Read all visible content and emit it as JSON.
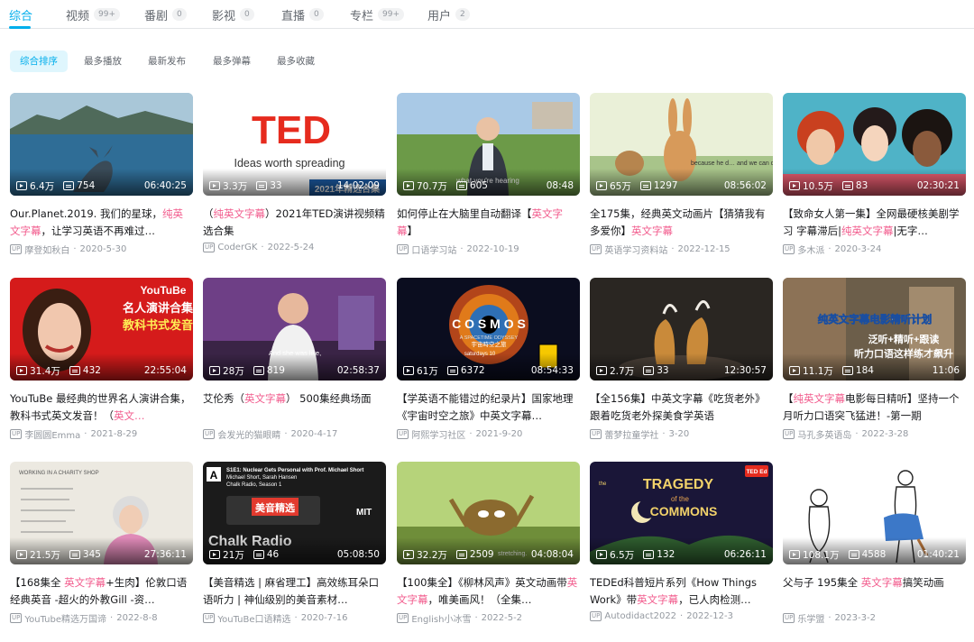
{
  "tabs": [
    {
      "label": "综合",
      "count": ""
    },
    {
      "label": "视频",
      "count": "99+"
    },
    {
      "label": "番剧",
      "count": "0"
    },
    {
      "label": "影视",
      "count": "0"
    },
    {
      "label": "直播",
      "count": "0"
    },
    {
      "label": "专栏",
      "count": "99+"
    },
    {
      "label": "用户",
      "count": "2"
    }
  ],
  "sort": [
    "综合排序",
    "最多播放",
    "最新发布",
    "最多弹幕",
    "最多收藏"
  ],
  "up_badge": "UP",
  "videos": [
    {
      "views": "6.4万",
      "danmaku": "754",
      "duration": "06:40:25",
      "t1": "Our.Planet.2019. 我们的星球，",
      "hl": "纯英文字幕",
      "t2": "，让学习英语不再难过…",
      "author": "摩登如秋白",
      "date": "2020-5-30",
      "overlay": ""
    },
    {
      "views": "3.3万",
      "danmaku": "33",
      "duration": "14:02:09",
      "t1": "（",
      "hl": "纯英文字幕",
      "t2": "）2021年TED演讲视频精选合集",
      "author": "CoderGK",
      "date": "2022-5-24",
      "overlay": "TED|Ideas worth spreading|2021年精选合集"
    },
    {
      "views": "70.7万",
      "danmaku": "605",
      "duration": "08:48",
      "t1": "如何停止在大脑里自动翻译【",
      "hl": "英文字幕",
      "t2": "】",
      "author": "口语学习站",
      "date": "2022-10-19",
      "overlay": "what you're hearing"
    },
    {
      "views": "65万",
      "danmaku": "1297",
      "duration": "08:56:02",
      "t1": "全175集，经典英文动画片【猜猜我有多爱你】",
      "hl": "英文字幕",
      "t2": "",
      "author": "英语学习资料站",
      "date": "2022-12-15",
      "overlay": "because he d… and we can d…"
    },
    {
      "views": "10.5万",
      "danmaku": "83",
      "duration": "02:30:21",
      "t1": "【致命女人第一集】全网最硬核美剧学习 字幕滞后|",
      "hl": "纯英文字幕",
      "t2": "|无字…",
      "author": "多木派",
      "date": "2020-3-24",
      "overlay": ""
    },
    {
      "views": "31.4万",
      "danmaku": "432",
      "duration": "22:55:04",
      "t1": "YouTuBe 最经典的世界名人演讲合集，教科书式英文发音！（",
      "hl": "英文…",
      "t2": "",
      "author": "李圆圆Emma",
      "date": "2021-8-29",
      "overlay": "YouTuBe|名人演讲合集|教科书式发音"
    },
    {
      "views": "28万",
      "danmaku": "819",
      "duration": "02:58:37",
      "t1": "艾伦秀（",
      "hl": "英文字幕",
      "t2": "） 500集经典场面",
      "author": "会发光的猫眼睛",
      "date": "2020-4-17",
      "overlay": "And she was like,"
    },
    {
      "views": "61万",
      "danmaku": "6372",
      "duration": "08:54:33",
      "t1": "【学英语不能错过的纪录片】国家地理《宇宙时空之旅》中英文字幕…",
      "hl": "",
      "t2": "",
      "author": "阿熙学习社区",
      "date": "2021-9-20",
      "overlay": "C O S M O S|A SPACETIME ODYSSEY|宇宙時空之旅|saturdays 10"
    },
    {
      "views": "2.7万",
      "danmaku": "33",
      "duration": "12:30:57",
      "t1": "【全156集】中英文字幕《吃货老外》跟着吃货老外探美食学英语",
      "hl": "",
      "t2": "",
      "author": "蕾梦拉童学社",
      "date": "3-20",
      "overlay": ""
    },
    {
      "views": "11.1万",
      "danmaku": "184",
      "duration": "11:06",
      "t1": "【",
      "hl": "纯英文字幕",
      "t2": "电影每日精听】坚持一个月听力口语突飞猛进！-第一期",
      "author": "马孔多英语岛",
      "date": "2022-3-28",
      "overlay": "纯英文字幕电影精听计划|泛听+精听+跟读|听力口语这样练才飙升"
    },
    {
      "views": "21.5万",
      "danmaku": "345",
      "duration": "27:36:11",
      "t1": "【168集全 ",
      "hl": "英文字幕",
      "t2": "+生肉】伦敦口语 经典英音 -超火的外教Gill -资…",
      "author": "YouTube精选万国谛",
      "date": "2022-8-8",
      "overlay": "WORKING IN A CHARITY SHOP"
    },
    {
      "views": "21万",
      "danmaku": "46",
      "duration": "05:08:50",
      "t1": "【美音精选 | 麻省理工】高效练耳朵口语听力 | 神仙级别的美音素材…",
      "hl": "",
      "t2": "",
      "author": "YouTuBe口语精选",
      "date": "2020-7-16",
      "overlay": "S1E1: Nuclear Gets Personal with Prof. Michael Short|Michael Short, Sarah Hansen|Chalk Radio, Season 1|美音精选|Chalk Radio|MIT"
    },
    {
      "views": "32.2万",
      "danmaku": "2509",
      "duration": "04:08:04",
      "t1": "【100集全】《柳林风声》英文动画带",
      "hl": "英文字幕",
      "t2": "，唯美画风！（全集…",
      "author": "English小冰雪",
      "date": "2022-5-2",
      "overlay": "stretching."
    },
    {
      "views": "6.5万",
      "danmaku": "132",
      "duration": "06:26:11",
      "t1": "TEDEd科普短片系列《How Things Work》带",
      "hl": "英文字幕",
      "t2": "，已人肉检测…",
      "author": "Autodidact2022",
      "date": "2022-12-3",
      "overlay": "the TRAGEDY|of the|COMMONS|TED Ed"
    },
    {
      "views": "108.1万",
      "danmaku": "4588",
      "duration": "01:40:21",
      "t1": "父与子 195集全 ",
      "hl": "英文字幕",
      "t2": "搞笑动画",
      "author": "乐学盟",
      "date": "2023-3-2",
      "overlay": ""
    }
  ],
  "colors": {
    "accent": "#00aeec",
    "highlight": "#f25d8e",
    "muted": "#9499a0"
  }
}
